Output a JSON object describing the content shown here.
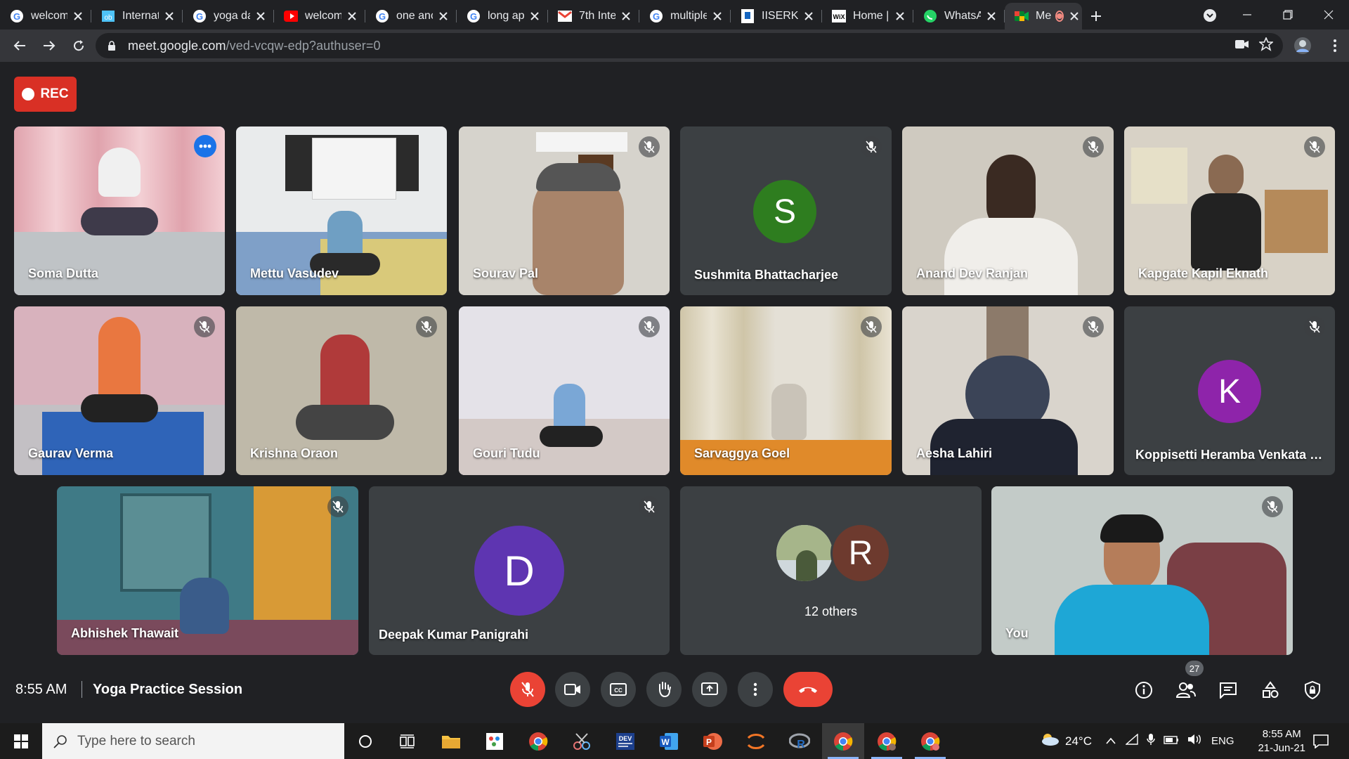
{
  "browser": {
    "tabs": [
      {
        "label": "welcom",
        "favicon": "google-g-icon"
      },
      {
        "label": "Internat",
        "favicon": "site-icon"
      },
      {
        "label": "yoga da",
        "favicon": "google-g-icon"
      },
      {
        "label": "welcom",
        "favicon": "youtube-icon"
      },
      {
        "label": "one anc",
        "favicon": "google-g-icon"
      },
      {
        "label": "long ap",
        "favicon": "google-g-icon"
      },
      {
        "label": "7th Inte",
        "favicon": "gmail-icon"
      },
      {
        "label": "multiple",
        "favicon": "google-g-icon"
      },
      {
        "label": "IISERKO",
        "favicon": "site-icon"
      },
      {
        "label": "Home |",
        "favicon": "wix-icon"
      },
      {
        "label": "WhatsA",
        "favicon": "whatsapp-icon"
      },
      {
        "label": "Me",
        "favicon": "meet-icon",
        "active": true
      }
    ],
    "url_host": "meet.google.com",
    "url_path": "/ved-vcqw-edp?authuser=0"
  },
  "meet": {
    "rec_label": "REC",
    "participants": [
      {
        "name": "Soma Dutta"
      },
      {
        "name": "Mettu Vasudev"
      },
      {
        "name": "Sourav Pal"
      },
      {
        "name": "Sushmita Bhattacharjee",
        "initial": "S"
      },
      {
        "name": "Anand Dev Ranjan"
      },
      {
        "name": "Kapgate Kapil Eknath"
      },
      {
        "name": "Gaurav Verma"
      },
      {
        "name": "Krishna Oraon"
      },
      {
        "name": "Gouri Tudu"
      },
      {
        "name": "Sarvaggya Goel"
      },
      {
        "name": "Aesha Lahiri"
      },
      {
        "name": "Koppisetti Heramba Venkata S...",
        "initial": "K"
      },
      {
        "name": "Abhishek Thawait"
      },
      {
        "name": "Deepak Kumar Panigrahi",
        "initial": "D"
      },
      {
        "name": "You"
      }
    ],
    "others": {
      "label": "12 others",
      "initial": "R"
    },
    "time": "8:55 AM",
    "meeting_title": "Yoga Practice Session",
    "participant_count": "27"
  },
  "taskbar": {
    "search_placeholder": "Type here to search",
    "weather": "24°C",
    "lang": "ENG",
    "clock_time": "8:55 AM",
    "clock_date": "21-Jun-21"
  },
  "colors": {
    "accent_blue": "#8ab4f8",
    "rec_red": "#d93025",
    "end_call_red": "#ea4335",
    "avatar_s": "#2e7d1f",
    "avatar_k": "#8e24aa",
    "avatar_d": "#5e35b1",
    "avatar_r": "#6d3a2e"
  }
}
